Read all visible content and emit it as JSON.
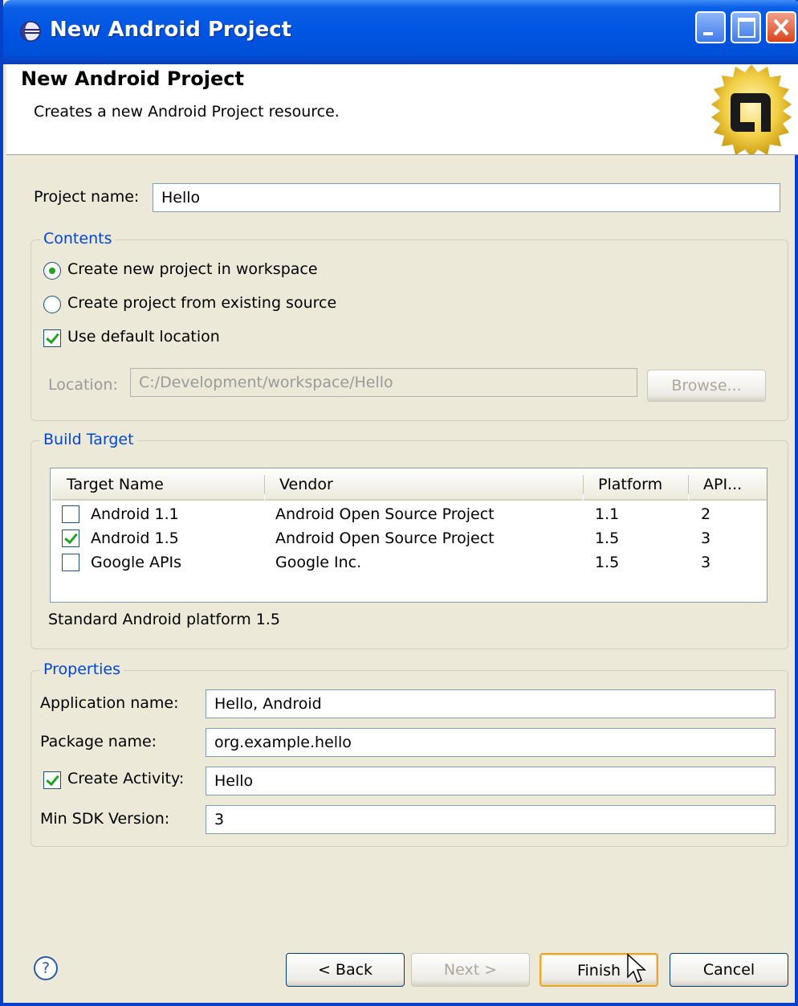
{
  "window": {
    "title": "New Android Project"
  },
  "header": {
    "title": "New Android Project",
    "description": "Creates a new Android Project resource."
  },
  "project_name": {
    "label": "Project name:",
    "value": "Hello"
  },
  "contents": {
    "group_title": "Contents",
    "radio_new": {
      "label": "Create new project in workspace",
      "checked": true
    },
    "radio_existing": {
      "label": "Create project from existing source",
      "checked": false
    },
    "use_default_location": {
      "label": "Use default location",
      "checked": true
    },
    "location_label": "Location:",
    "location_value": "C:/Development/workspace/Hello",
    "browse_label": "Browse..."
  },
  "build_target": {
    "group_title": "Build Target",
    "columns": [
      "Target Name",
      "Vendor",
      "Platform",
      "API..."
    ],
    "rows": [
      {
        "checked": false,
        "name": "Android 1.1",
        "vendor": "Android Open Source Project",
        "platform": "1.1",
        "api": "2"
      },
      {
        "checked": true,
        "name": "Android 1.5",
        "vendor": "Android Open Source Project",
        "platform": "1.5",
        "api": "3"
      },
      {
        "checked": false,
        "name": "Google APIs",
        "vendor": "Google Inc.",
        "platform": "1.5",
        "api": "3"
      }
    ],
    "description": "Standard Android platform 1.5"
  },
  "properties": {
    "group_title": "Properties",
    "app_name_label": "Application name:",
    "app_name_value": "Hello, Android",
    "package_label": "Package name:",
    "package_value": "org.example.hello",
    "create_activity_label": "Create Activity:",
    "create_activity_checked": true,
    "activity_value": "Hello",
    "min_sdk_label": "Min SDK Version:",
    "min_sdk_value": "3"
  },
  "footer": {
    "help_icon": "?",
    "back_label": "< Back",
    "next_label": "Next >",
    "finish_label": "Finish",
    "cancel_label": "Cancel"
  },
  "colors": {
    "titlebar": "#0054e3",
    "group_title": "#0046d5",
    "check_green": "#21a121"
  }
}
